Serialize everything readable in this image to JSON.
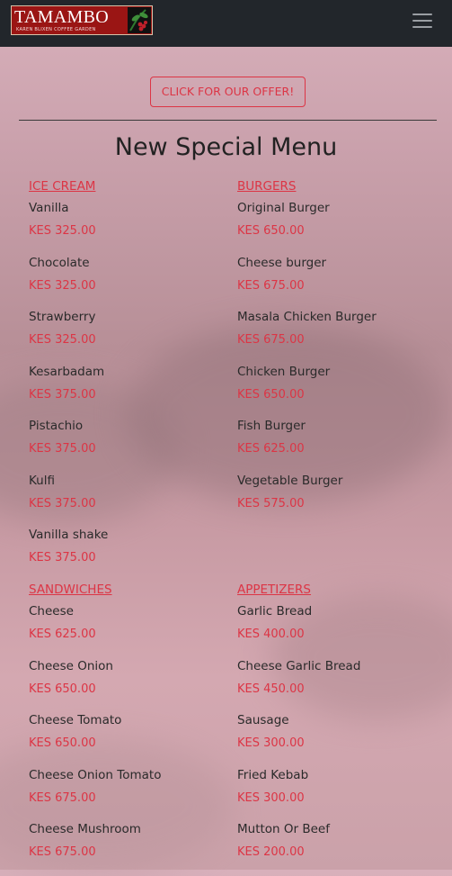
{
  "brand": {
    "name": "TAMAMBO",
    "tagline": "KAREN BLIXEN COFFEE GARDEN"
  },
  "offer_button": "CLICK FOR OUR OFFER!",
  "menu_title": "New Special Menu",
  "sections": [
    {
      "category": "ICE CREAM",
      "items": [
        {
          "name": "Vanilla",
          "price": "KES 325.00"
        },
        {
          "name": "Chocolate",
          "price": "KES 325.00"
        },
        {
          "name": "Strawberry",
          "price": "KES 325.00"
        },
        {
          "name": "Kesarbadam",
          "price": "KES 375.00"
        },
        {
          "name": "Pistachio",
          "price": "KES 375.00"
        },
        {
          "name": "Kulfi",
          "price": "KES 375.00"
        },
        {
          "name": "Vanilla shake",
          "price": "KES 375.00"
        }
      ]
    },
    {
      "category": "BURGERS",
      "items": [
        {
          "name": "Original Burger",
          "price": "KES 650.00"
        },
        {
          "name": "Cheese burger",
          "price": "KES 675.00"
        },
        {
          "name": "Masala Chicken Burger",
          "price": "KES 675.00"
        },
        {
          "name": "Chicken Burger",
          "price": "KES 650.00"
        },
        {
          "name": "Fish Burger",
          "price": "KES 625.00"
        },
        {
          "name": "Vegetable Burger",
          "price": "KES 575.00"
        }
      ]
    },
    {
      "category": "SANDWICHES",
      "items": [
        {
          "name": "Cheese",
          "price": "KES 625.00"
        },
        {
          "name": "Cheese Onion",
          "price": "KES 650.00"
        },
        {
          "name": "Cheese Tomato",
          "price": "KES 650.00"
        },
        {
          "name": "Cheese Onion Tomato",
          "price": "KES 675.00"
        },
        {
          "name": "Cheese Mushroom",
          "price": "KES 675.00"
        }
      ]
    },
    {
      "category": "APPETIZERS",
      "items": [
        {
          "name": "Garlic Bread",
          "price": "KES 400.00"
        },
        {
          "name": "Cheese Garlic Bread",
          "price": "KES 450.00"
        },
        {
          "name": "Sausage",
          "price": "KES 300.00"
        },
        {
          "name": "Fried Kebab",
          "price": "KES 300.00"
        },
        {
          "name": "Mutton Or Beef",
          "price": "KES 200.00"
        }
      ]
    }
  ],
  "icons": {
    "menu_toggle": "hamburger-icon"
  },
  "colors": {
    "navbar": "#22262b",
    "accent": "#dc3545",
    "logo_bg": "#9a1514"
  }
}
